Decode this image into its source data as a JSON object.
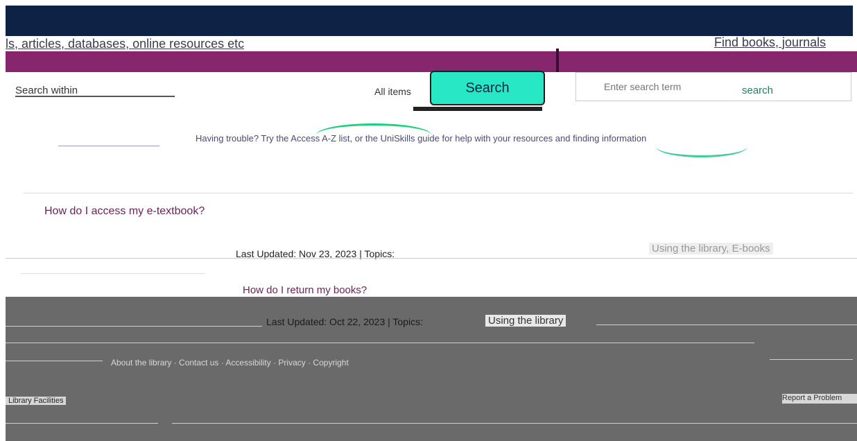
{
  "header": {
    "left_heading": "ls, articles, databases, online resources etc",
    "right_heading": "Find books, journals"
  },
  "search": {
    "scope_label": "Search within",
    "all_items": "All items",
    "button_label": "Search",
    "right_placeholder": "Enter search term",
    "right_search_label": "search"
  },
  "notice": {
    "text": "Having trouble? Try the Access A-Z list, or the UniSkills guide for help with your resources and finding information"
  },
  "faqs": [
    {
      "question": "How do I access my e-textbook?",
      "meta": "Last Updated: Nov 23, 2023 | Topics:",
      "topic": "Using the library, E-books"
    },
    {
      "question": "How do I return my books?",
      "meta": "Last Updated: Oct 22, 2023 | Topics:",
      "topic": "Using the library"
    }
  ],
  "footer": {
    "links_text": "About the library · Contact us · Accessibility · Privacy · Copyright",
    "bottom_left": "Library Facilities",
    "bottom_right": "Report a Problem"
  },
  "colors": {
    "navy": "#0d2245",
    "purple": "#86276e",
    "accent": "#28e7c4",
    "footer_grey": "#6a6a6a"
  }
}
